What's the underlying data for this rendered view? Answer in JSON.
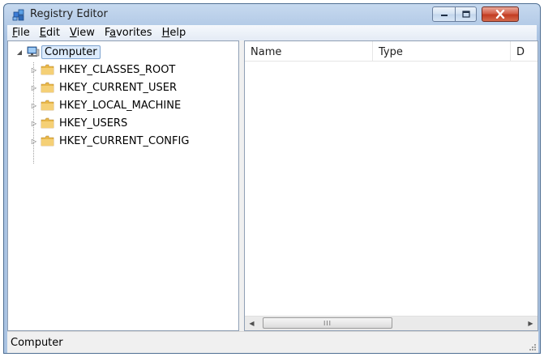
{
  "window": {
    "title": "Registry Editor",
    "app_icon": "registry-editor-icon"
  },
  "menu": {
    "items": [
      {
        "label": "File",
        "accesskey": "F"
      },
      {
        "label": "Edit",
        "accesskey": "E"
      },
      {
        "label": "View",
        "accesskey": "V"
      },
      {
        "label": "Favorites",
        "accesskey": "a"
      },
      {
        "label": "Help",
        "accesskey": "H"
      }
    ]
  },
  "tree": {
    "root": {
      "label": "Computer",
      "icon": "computer-icon",
      "selected": true,
      "expanded": true
    },
    "children": [
      {
        "label": "HKEY_CLASSES_ROOT",
        "icon": "folder-icon"
      },
      {
        "label": "HKEY_CURRENT_USER",
        "icon": "folder-icon"
      },
      {
        "label": "HKEY_LOCAL_MACHINE",
        "icon": "folder-icon"
      },
      {
        "label": "HKEY_USERS",
        "icon": "folder-icon"
      },
      {
        "label": "HKEY_CURRENT_CONFIG",
        "icon": "folder-icon"
      }
    ]
  },
  "list": {
    "columns": [
      {
        "label": "Name"
      },
      {
        "label": "Type"
      },
      {
        "label": "D"
      }
    ],
    "scroll_thumb_glyph": "III"
  },
  "status": {
    "text": "Computer"
  },
  "colors": {
    "selection_border": "#7da2ce",
    "selection_fill": "#dcebfc",
    "close_button": "#c23c22",
    "frame": "#b7cde8"
  }
}
